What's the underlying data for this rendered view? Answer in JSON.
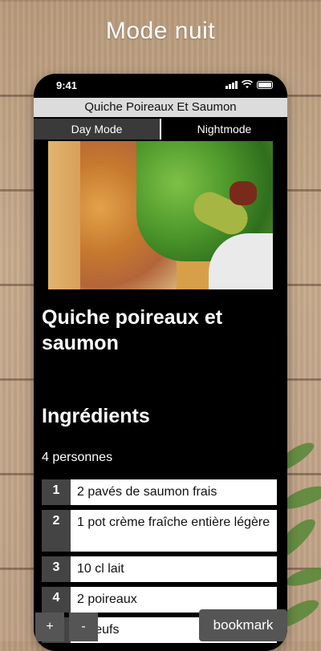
{
  "promo": {
    "title": "Mode nuit"
  },
  "status": {
    "time": "9:41"
  },
  "app": {
    "header_title": "Quiche Poireaux Et Saumon"
  },
  "modes": {
    "day": "Day Mode",
    "night": "Nightmode",
    "active": "night"
  },
  "recipe": {
    "title": "Quiche poireaux et saumon",
    "ingredients_heading": "Ingrédients",
    "servings": "4 personnes",
    "ingredients": [
      {
        "num": "1",
        "text": "2 pavés de saumon frais"
      },
      {
        "num": "2",
        "text": "1 pot crème fraîche entière légère"
      },
      {
        "num": "3",
        "text": "10 cl lait"
      },
      {
        "num": "4",
        "text": "2 poireaux"
      },
      {
        "num": "5",
        "text": "3 oeufs"
      }
    ]
  },
  "controls": {
    "zoom_in": "+",
    "zoom_out": "-",
    "bookmark": "bookmark"
  },
  "colors": {
    "background_app": "#000000",
    "header": "#dcdcdc",
    "tab_inactive": "#3a3a3a",
    "button": "#555555"
  }
}
